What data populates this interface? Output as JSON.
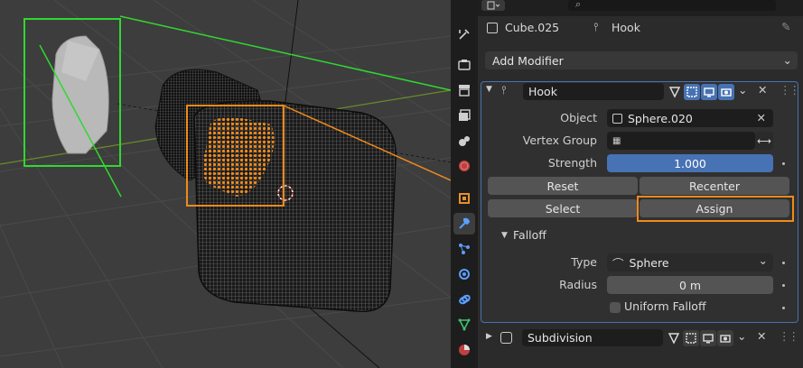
{
  "context": {
    "object_name": "Cube.025",
    "modifier_name": "Hook"
  },
  "add_modifier_label": "Add Modifier",
  "hook_modifier": {
    "name": "Hook",
    "object_label": "Object",
    "object_value": "Sphere.020",
    "vertex_group_label": "Vertex Group",
    "vertex_group_value": "",
    "strength_label": "Strength",
    "strength_value": "1.000",
    "strength_fraction": 1.0,
    "reset_label": "Reset",
    "recenter_label": "Recenter",
    "select_label": "Select",
    "assign_label": "Assign",
    "falloff": {
      "title": "Falloff",
      "type_label": "Type",
      "type_value": "Sphere",
      "radius_label": "Radius",
      "radius_value": "0 m",
      "uniform_label": "Uniform Falloff",
      "uniform_checked": false
    }
  },
  "subdivision_modifier": {
    "name": "Subdivision"
  },
  "colors": {
    "accent_blue": "#4772b3",
    "highlight_green": "#30d830",
    "highlight_orange": "#f08a1a",
    "selected_vertices": "#f08a1a"
  },
  "tabs": [
    "tool-icon",
    "render-icon",
    "output-icon",
    "view-layer-icon",
    "scene-icon",
    "world-icon",
    "object-icon",
    "modifier-icon",
    "particles-icon",
    "physics-icon",
    "constraints-icon",
    "data-icon",
    "material-icon"
  ]
}
